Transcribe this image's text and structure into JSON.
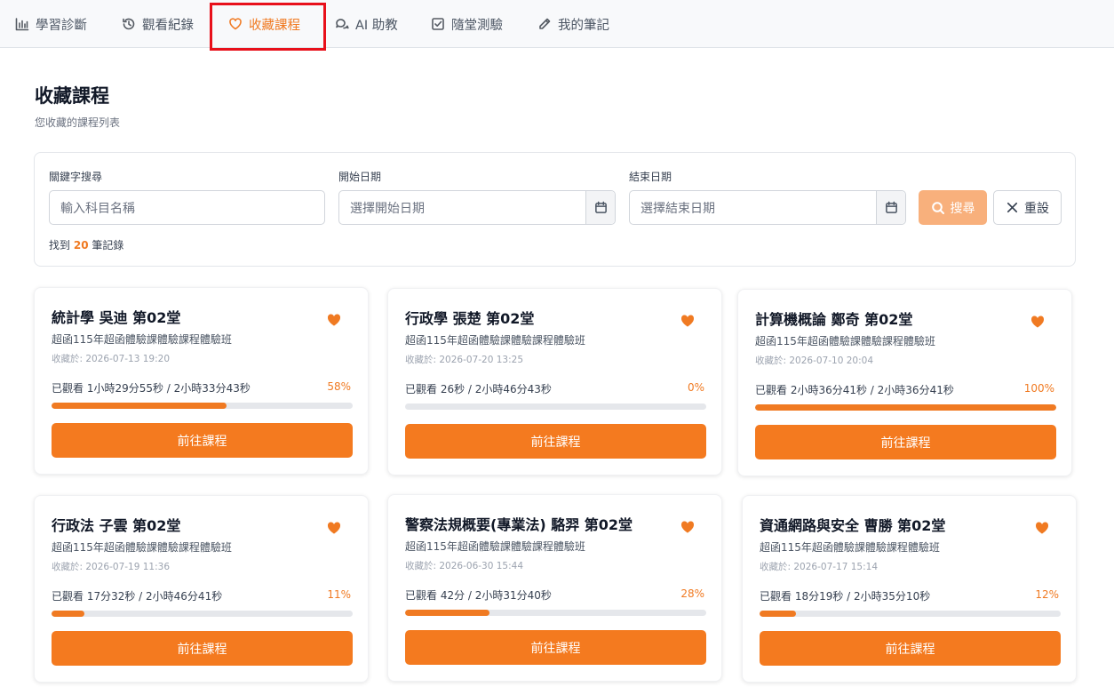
{
  "nav": {
    "tabs": [
      {
        "label": "學習診斷",
        "icon": "bar-chart-icon",
        "active": false
      },
      {
        "label": "觀看紀錄",
        "icon": "history-icon",
        "active": false
      },
      {
        "label": "收藏課程",
        "icon": "heart-outline-icon",
        "active": true
      },
      {
        "label": "AI 助教",
        "icon": "chat-bubbles-icon",
        "active": false
      },
      {
        "label": "隨堂測驗",
        "icon": "checkbox-icon",
        "active": false
      },
      {
        "label": "我的筆記",
        "icon": "pencil-icon",
        "active": false
      }
    ]
  },
  "header": {
    "title": "收藏課程",
    "subtitle": "您收藏的課程列表"
  },
  "filters": {
    "keyword_label": "關鍵字搜尋",
    "keyword_placeholder": "輸入科目名稱",
    "start_label": "開始日期",
    "start_placeholder": "選擇開始日期",
    "end_label": "結束日期",
    "end_placeholder": "選擇結束日期",
    "search_label": "搜尋",
    "reset_label": "重設",
    "count_prefix": "找到",
    "count": "20",
    "count_suffix": "筆記錄"
  },
  "colors": {
    "accent": "#f07a22",
    "highlight_box": "#e8101b",
    "search_disabled": "#f8b07c"
  },
  "courses": [
    {
      "title": "統計學 吳迪 第02堂",
      "class": "超函115年超函體驗課體驗課程體驗班",
      "saved": "收藏於: 2026-07-13 19:20",
      "watched": "已觀看 1小時29分55秒 / 2小時33分43秒",
      "percent": "58%",
      "progress": 0.58,
      "button": "前往課程"
    },
    {
      "title": "行政學 張楚 第02堂",
      "class": "超函115年超函體驗課體驗課程體驗班",
      "saved": "收藏於: 2026-07-20 13:25",
      "watched": "已觀看 26秒 / 2小時46分43秒",
      "percent": "0%",
      "progress": 0.0,
      "button": "前往課程"
    },
    {
      "title": "計算機概論 鄭奇 第02堂",
      "class": "超函115年超函體驗課體驗課程體驗班",
      "saved": "收藏於: 2026-07-10 20:04",
      "watched": "已觀看 2小時36分41秒 / 2小時36分41秒",
      "percent": "100%",
      "progress": 1.0,
      "button": "前往課程"
    },
    {
      "title": "行政法 子雲 第02堂",
      "class": "超函115年超函體驗課體驗課程體驗班",
      "saved": "收藏於: 2026-07-19 11:36",
      "watched": "已觀看 17分32秒 / 2小時46分41秒",
      "percent": "11%",
      "progress": 0.11,
      "button": "前往課程"
    },
    {
      "title": "警察法規概要(專業法) 駱羿 第02堂",
      "class": "超函115年超函體驗課體驗課程體驗班",
      "saved": "收藏於: 2026-06-30 15:44",
      "watched": "已觀看 42分 / 2小時31分40秒",
      "percent": "28%",
      "progress": 0.28,
      "button": "前往課程"
    },
    {
      "title": "資通網路與安全 曹勝 第02堂",
      "class": "超函115年超函體驗課體驗課程體驗班",
      "saved": "收藏於: 2026-07-17 15:14",
      "watched": "已觀看 18分19秒 / 2小時35分10秒",
      "percent": "12%",
      "progress": 0.12,
      "button": "前往課程"
    }
  ]
}
